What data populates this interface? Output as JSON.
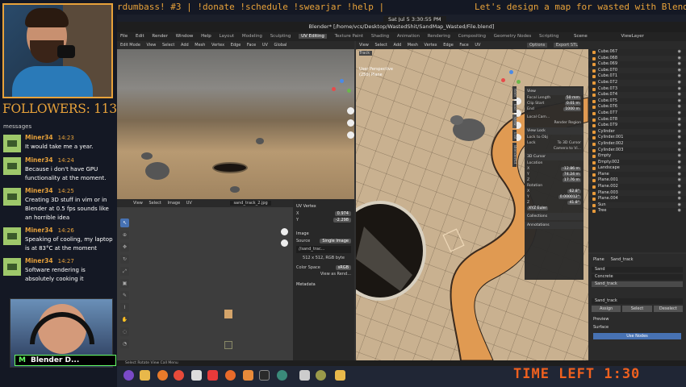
{
  "ticker": {
    "left_text": "rdumbass! #3 | !donate !schedule !swearjar !help |",
    "right_text": "Let's design a map for wasted with Blender"
  },
  "clock": "Sat Jul 5  3:30:55 PM",
  "followers": "FOLLOWERS: 113",
  "chat": {
    "partial": "messages",
    "messages": [
      {
        "user": "Miner34",
        "time": "14:23",
        "text": "It would take me a year."
      },
      {
        "user": "Miner34",
        "time": "14:24",
        "text": "Because i don't have GPU functionality at the moment."
      },
      {
        "user": "Miner34",
        "time": "14:25",
        "text": "Creating 3D stuff in vim or in Blender at 0.5 fps sounds like an horrible idea"
      },
      {
        "user": "Miner34",
        "time": "14:26",
        "text": "Speaking of cooling, my laptop is at 83°C at the moment"
      },
      {
        "user": "Miner34",
        "time": "14:27",
        "text": "Software rendering is absolutely cooking it"
      }
    ]
  },
  "cam_badge": {
    "icon": "M",
    "label": "Blender D..."
  },
  "blender": {
    "title": "Blender* [/home/vcs/Desktop/WastedShit/SandMap_Wasted/File.blend]",
    "menus": [
      "File",
      "Edit",
      "Render",
      "Window",
      "Help"
    ],
    "workspaces": [
      "Layout",
      "Modeling",
      "Sculpting",
      "UV Editing",
      "Texture Paint",
      "Shading",
      "Animation",
      "Rendering",
      "Compositing",
      "Geometry Nodes",
      "Scripting"
    ],
    "active_workspace": "UV Editing",
    "scene": "Scene",
    "view_layer": "ViewLayer",
    "vp1_header": [
      "Edit Mode",
      "View",
      "Select",
      "Add",
      "Mesh",
      "Vertex",
      "Edge",
      "Face",
      "UV",
      "Global"
    ],
    "uv_header": [
      "View",
      "Select",
      "Image",
      "UV"
    ],
    "uv_image": "sand_track_2.jpg",
    "npanel": {
      "uv_vertex": "UV Vertex",
      "x_label": "X",
      "x_val": "0.974",
      "y_label": "Y",
      "y_val": "-2.298",
      "image_label": "Image",
      "source_label": "Source",
      "source_val": "Single Image",
      "file_name": "//sand_trac...",
      "img_size": "512 x 512, RGB byte",
      "color_space_label": "Color Space",
      "color_space_val": "sRGB",
      "view_as_render": "View as Rend...",
      "metadata": "Metadata"
    },
    "vp2_header": [
      "View",
      "Select",
      "Add",
      "Mesh",
      "Vertex",
      "Edge",
      "Face",
      "UV"
    ],
    "vp2_info": {
      "line1": "User Perspective",
      "line2": "(250) Plane"
    },
    "options_label": "Options",
    "export_label": "Export STL Track",
    "side_tabs": [
      "Item",
      "Tool",
      "View",
      "Edit",
      "BlenderKit"
    ],
    "view_panel": {
      "title": "View",
      "focal_label": "Focal Length",
      "focal_val": "50 mm",
      "clip_start_label": "Clip Start",
      "clip_start_val": "0.01 m",
      "end_label": "End",
      "end_val": "1000 m",
      "local_camera": "Local Cam...",
      "render_region": "Render Region",
      "view_lock": "View Lock",
      "lock_obj": "Lock to Obj",
      "lock_label": "Lock",
      "lock_3d": "To 3D Cursor",
      "camera_to_view": "Camera to Vi...",
      "cursor_title": "3D Cursor",
      "location": "Location",
      "cx": "-12.86 m",
      "cy": "74.24 m",
      "cz": "17.76 m",
      "rotation": "Rotation",
      "rx": "62.8°",
      "ry": "0.000012°",
      "rz": "41.8°",
      "rot_mode": "XYZ Euler",
      "collections": "Collections",
      "annotations": "Annotations"
    },
    "outliner": [
      "Cube.067",
      "Cube.068",
      "Cube.069",
      "Cube.070",
      "Cube.071",
      "Cube.072",
      "Cube.073",
      "Cube.074",
      "Cube.075",
      "Cube.076",
      "Cube.077",
      "Cube.078",
      "Cube.079",
      "Cylinder",
      "Cylinder.001",
      "Cylinder.002",
      "Cylinder.003",
      "Empty",
      "Empty.002",
      "Landscape",
      "Plane",
      "Plane.001",
      "Plane.002",
      "Plane.003",
      "Plane.004",
      "Sun",
      "Tree"
    ],
    "props": {
      "object": "Plane",
      "material": "Sand_track",
      "slots": [
        "Sand",
        "Concrete",
        "Sand_track"
      ],
      "selected_slot": "Sand_track",
      "assign": "Assign",
      "select": "Select",
      "deselect": "Deselect",
      "preview": "Preview",
      "surface": "Surface",
      "use_nodes": "Use Nodes"
    },
    "status": "Select          Rotate View          Call Menu"
  },
  "time_left": "TIME LEFT 1:30",
  "accent": "#e8a23a",
  "timer_color": "#f0601e"
}
